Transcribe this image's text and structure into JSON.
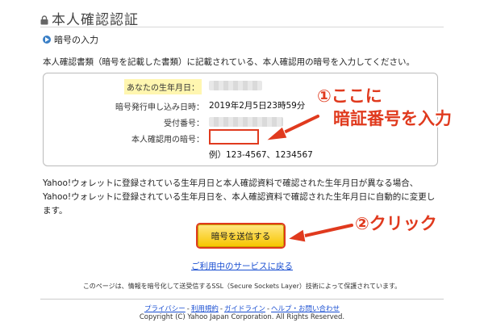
{
  "page": {
    "title": "本人確認認証",
    "section_heading": "暗号の入力",
    "intro_text": "本人確認書類（暗号を記載した書類）に記載されている、本人確認用の暗号を入力してください。"
  },
  "form": {
    "birthdate_label": "あなたの生年月日：",
    "request_datetime_label": "暗号発行申し込み日時：",
    "request_datetime_value": "2019年2月5日23時59分",
    "receipt_number_label": "受付番号：",
    "code_label": "本人確認用の暗号：",
    "code_value": "",
    "code_example": "例）123-4567、1234567"
  },
  "notice": {
    "line1": "Yahoo!ウォレットに登録されている生年月日と本人確認資料で確認された生年月日が異なる場合、",
    "line2": "Yahoo!ウォレットに登録されている生年月日を、本人確認資料で確認された生年月日に自動的に変更し",
    "line3": "ます。"
  },
  "buttons": {
    "submit_label": "暗号を送信する"
  },
  "links": {
    "back_label": "ご利用中のサービスに戻る"
  },
  "ssl_note": "このページは、情報を暗号化して送受信するSSL（Secure Sockets Layer）技術によって保護されています。",
  "footer": {
    "links": [
      "プライバシー",
      "利用規約",
      "ガイドライン",
      "ヘルプ・お問い合わせ"
    ],
    "separator": "-",
    "copyright": "Copyright (C) Yahoo Japan Corporation. All Rights Reserved."
  },
  "annotations": {
    "step1_line1": "①ここに",
    "step1_line2": "暗証番号を入力",
    "step2": "②クリック"
  },
  "colors": {
    "annotation_red": "#e03a1e",
    "button_yellow": "#f7c600",
    "link_blue": "#1a4fd2",
    "highlight_yellow": "#fff6b0"
  }
}
